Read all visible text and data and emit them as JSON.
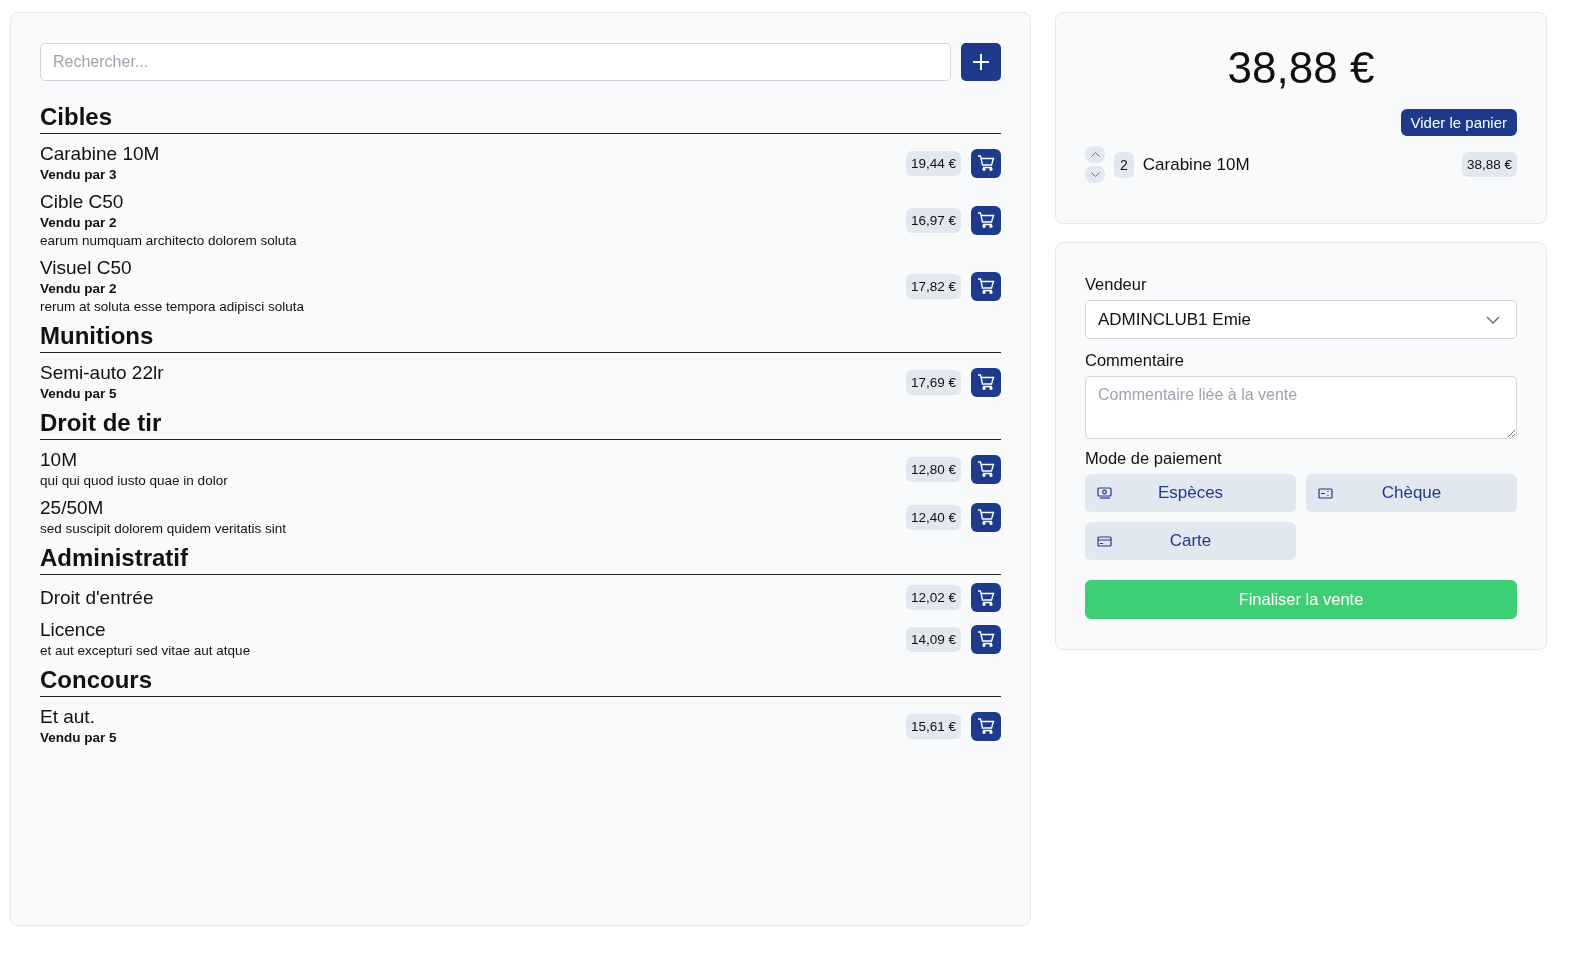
{
  "search": {
    "placeholder": "Rechercher..."
  },
  "categories": [
    {
      "title": "Cibles",
      "items": [
        {
          "name": "Carabine 10M",
          "sold_by": "Vendu par 3",
          "price": "19,44 €"
        },
        {
          "name": "Cible C50",
          "sold_by": "Vendu par 2",
          "description": "earum numquam architecto dolorem soluta",
          "price": "16,97 €"
        },
        {
          "name": "Visuel C50",
          "sold_by": "Vendu par 2",
          "description": "rerum at soluta esse tempora adipisci soluta",
          "price": "17,82 €"
        }
      ]
    },
    {
      "title": "Munitions",
      "items": [
        {
          "name": "Semi-auto 22lr",
          "sold_by": "Vendu par 5",
          "price": "17,69 €"
        }
      ]
    },
    {
      "title": "Droit de tir",
      "items": [
        {
          "name": "10M",
          "description": "qui qui quod iusto quae in dolor",
          "price": "12,80 €"
        },
        {
          "name": "25/50M",
          "description": "sed suscipit dolorem quidem veritatis sint",
          "price": "12,40 €"
        }
      ]
    },
    {
      "title": "Administratif",
      "items": [
        {
          "name": "Droit d'entrée",
          "price": "12,02 €"
        },
        {
          "name": "Licence",
          "description": "et aut excepturi sed vitae aut atque",
          "price": "14,09 €"
        }
      ]
    },
    {
      "title": "Concours",
      "items": [
        {
          "name": "Et aut.",
          "sold_by": "Vendu par 5",
          "price": "15,61 €"
        }
      ]
    }
  ],
  "cart": {
    "total": "38,88 €",
    "clear_button": "Vider le panier",
    "lines": [
      {
        "quantity": "2",
        "name": "Carabine 10M",
        "price": "38,88 €"
      }
    ]
  },
  "form": {
    "seller_label": "Vendeur",
    "seller_value": "ADMINCLUB1 Emie",
    "comment_label": "Commentaire",
    "comment_placeholder": "Commentaire liée à la vente",
    "payment_label": "Mode de paiement",
    "payment_modes": [
      {
        "kind": "cash",
        "label": "Espèces"
      },
      {
        "kind": "cheque",
        "label": "Chèque"
      },
      {
        "kind": "card",
        "label": "Carte"
      }
    ],
    "submit": "Finaliser la vente"
  }
}
